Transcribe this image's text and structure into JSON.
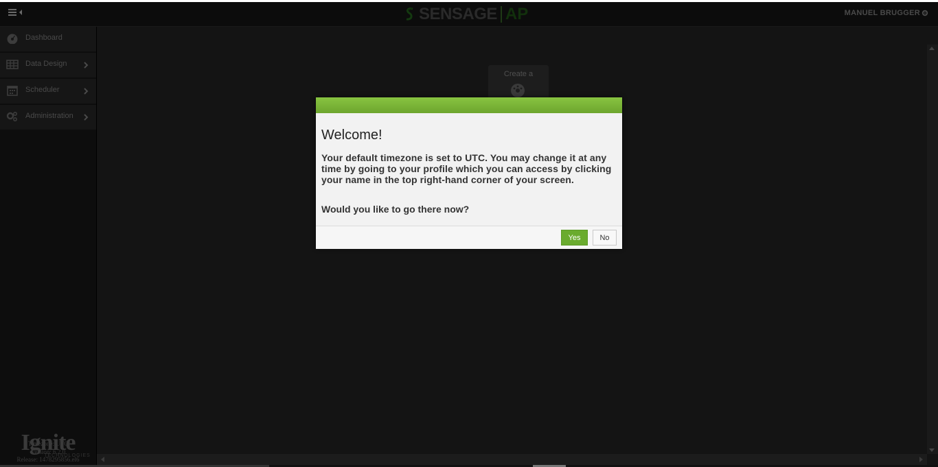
{
  "header": {
    "logo_main": "SENSAGE",
    "logo_suffix": "AP",
    "user_name": "MANUEL BRUGGER"
  },
  "sidebar": {
    "items": [
      {
        "label": "Dashboard",
        "icon": "dashboard-icon",
        "has_submenu": false
      },
      {
        "label": "Data Design",
        "icon": "table-icon",
        "has_submenu": true
      },
      {
        "label": "Scheduler",
        "icon": "calendar-icon",
        "has_submenu": true
      },
      {
        "label": "Administration",
        "icon": "gears-icon",
        "has_submenu": true
      }
    ],
    "brand": {
      "name": "Ignite",
      "subtitle": "TECHNOLOGIES"
    },
    "meta": {
      "timezone": "Timezone: UTC",
      "version": "Version: 6.2.0",
      "release": "Release: 1478295856.el6"
    }
  },
  "main": {
    "create_card_label": "Create a"
  },
  "modal": {
    "title": "Welcome!",
    "body": "Your default timezone is set to UTC. You may change it at any time by going to your profile which you can access by clicking your name in the top right-hand corner of your screen.",
    "question": "Would you like to go there now?",
    "yes_label": "Yes",
    "no_label": "No"
  },
  "colors": {
    "modal_bar": "#7ab83a",
    "yes_button": "#6aab2e",
    "background": "#141414"
  }
}
